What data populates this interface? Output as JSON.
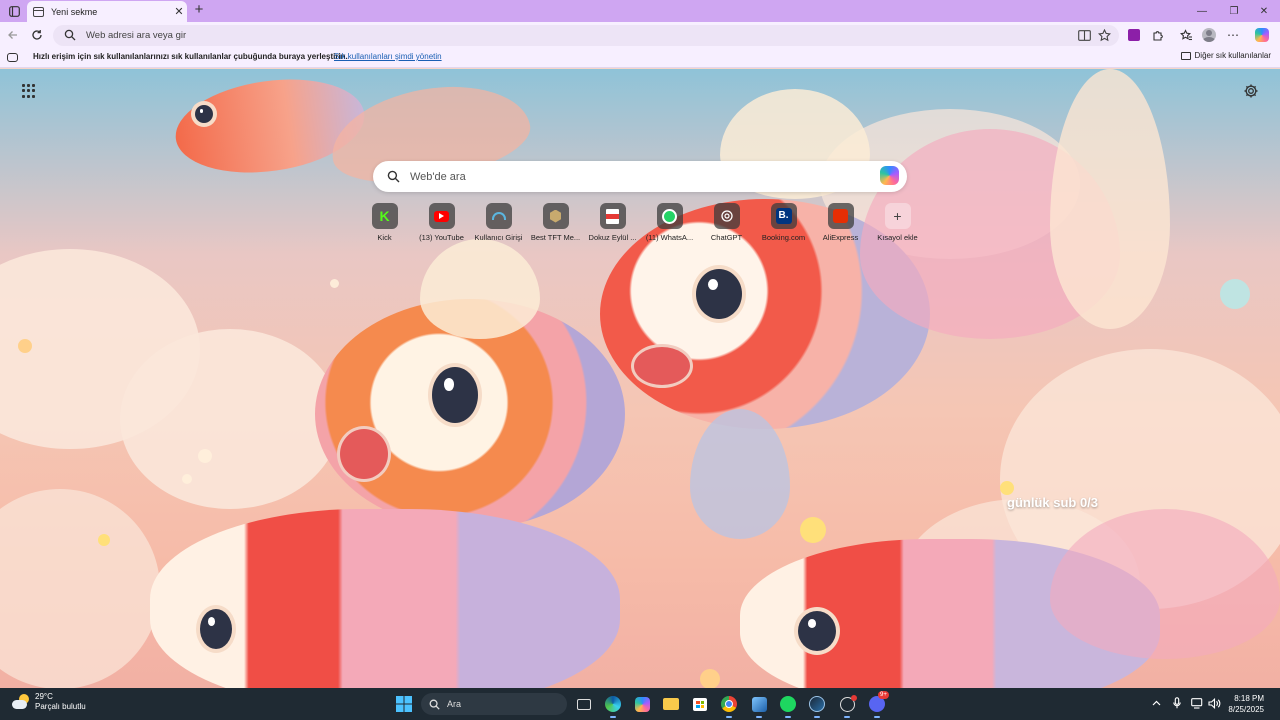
{
  "browser": {
    "tab_title": "Yeni sekme",
    "tab_close": "✕",
    "new_tab": "+",
    "window_controls": {
      "minimize": "—",
      "maximize": "❐",
      "close": "✕"
    }
  },
  "address_bar": {
    "placeholder": "Web adresi ara veya gir"
  },
  "favorites_bar": {
    "message": "Hızlı erişim için sık kullanılanlarınızı sık kullanılanlar çubuğunda buraya yerleştirin.",
    "manage_link": "Sık kullanılanları şimdi yönetin",
    "other_favorites": "Diğer sık kullanılanlar"
  },
  "new_tab_page": {
    "search_placeholder": "Web'de ara",
    "quick_links": [
      {
        "label": "Kick",
        "icon": "kick-icon",
        "color": "#53fc18"
      },
      {
        "label": "(13) YouTube",
        "icon": "youtube-icon",
        "color": "#ff0000"
      },
      {
        "label": "Kullanıcı Girişi",
        "icon": "login-icon",
        "color": "#5bb6e0"
      },
      {
        "label": "Best TFT Me...",
        "icon": "tft-icon",
        "color": "#c8aa6e"
      },
      {
        "label": "Dokuz Eylül ...",
        "icon": "pdf-icon",
        "color": "#e53935"
      },
      {
        "label": "(11) WhatsA...",
        "icon": "whatsapp-icon",
        "color": "#25d366"
      },
      {
        "label": "ChatGPT",
        "icon": "chatgpt-icon",
        "color": "#ffffff"
      },
      {
        "label": "Booking.com",
        "icon": "booking-icon",
        "color": "#003580"
      },
      {
        "label": "AliExpress",
        "icon": "aliexpress-icon",
        "color": "#e62e04"
      },
      {
        "label": "Kısayol ekle",
        "icon": "plus-icon",
        "color": "#444444"
      }
    ],
    "overlay_text": "günlük sub 0/3"
  },
  "taskbar": {
    "weather_temp": "29°C",
    "weather_desc": "Parçalı bulutlu",
    "search_label": "Ara",
    "time": "8:18 PM",
    "date": "8/25/2025",
    "discord_badge": "9+"
  }
}
